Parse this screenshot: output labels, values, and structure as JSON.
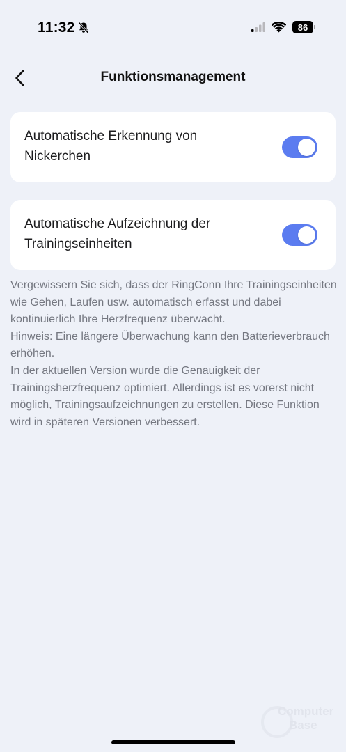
{
  "status_bar": {
    "time": "11:32",
    "battery": "86"
  },
  "header": {
    "title": "Funktionsmanagement"
  },
  "settings": [
    {
      "label": "Automatische Erkennung von Nickerchen",
      "enabled": true
    },
    {
      "label": "Automatische Aufzeichnung der Trainingseinheiten",
      "enabled": true
    }
  ],
  "description": {
    "para1": "Vergewissern Sie sich, dass der RingConn Ihre Trainingseinheiten wie Gehen, Laufen usw. automatisch erfasst und dabei kontinuierlich Ihre Herzfrequenz überwacht.",
    "para2": "Hinweis: Eine längere Überwachung kann den Batterieverbrauch erhöhen.",
    "para3": "In der aktuellen Version wurde die Genauigkeit der Trainingsherzfrequenz optimiert. Allerdings ist es vorerst nicht möglich, Trainingsaufzeichnungen zu erstellen. Diese Funktion wird in späteren Versionen verbessert."
  },
  "watermark": {
    "line1": "Computer",
    "line2": "Base"
  },
  "colors": {
    "background": "#eef1f8",
    "card": "#ffffff",
    "toggle_on": "#5b7cf0",
    "description_text": "#747780"
  }
}
